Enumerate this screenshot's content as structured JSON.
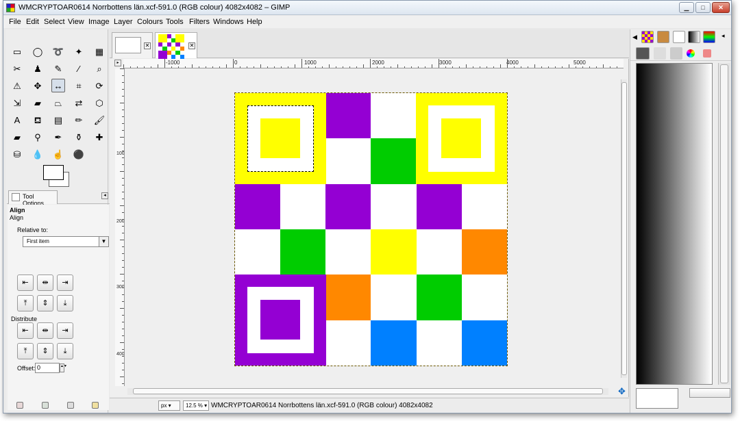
{
  "window": {
    "title": "WMCRYPTOAR0614 Norrbottens län.xcf-591.0 (RGB colour) 4082x4082 – GIMP",
    "buttons": {
      "minimize": "▁",
      "maximize": "□",
      "close": "✕"
    }
  },
  "menu": {
    "items": [
      "File",
      "Edit",
      "Select",
      "View",
      "Image",
      "Layer",
      "Colours",
      "Tools",
      "Filters",
      "Windows",
      "Help"
    ]
  },
  "toolbox": {
    "tools": [
      {
        "name": "rect-select-icon",
        "glyph": "▭"
      },
      {
        "name": "ellipse-select-icon",
        "glyph": "◯"
      },
      {
        "name": "lasso-icon",
        "glyph": "➰"
      },
      {
        "name": "fuzzy-select-icon",
        "glyph": "✦"
      },
      {
        "name": "color-select-icon",
        "glyph": "▦"
      },
      {
        "name": "scissors-icon",
        "glyph": "✂"
      },
      {
        "name": "foreground-select-icon",
        "glyph": "♟"
      },
      {
        "name": "paths-icon",
        "glyph": "✎"
      },
      {
        "name": "color-picker-icon",
        "glyph": "⁄"
      },
      {
        "name": "zoom-icon",
        "glyph": "⌕"
      },
      {
        "name": "measure-icon",
        "glyph": "⚠"
      },
      {
        "name": "move-icon",
        "glyph": "✥"
      },
      {
        "name": "align-icon",
        "glyph": "↔"
      },
      {
        "name": "crop-icon",
        "glyph": "⌗"
      },
      {
        "name": "rotate-icon",
        "glyph": "⟳"
      },
      {
        "name": "scale-icon",
        "glyph": "⇲"
      },
      {
        "name": "shear-icon",
        "glyph": "▰"
      },
      {
        "name": "perspective-icon",
        "glyph": "⏢"
      },
      {
        "name": "flip-icon",
        "glyph": "⇄"
      },
      {
        "name": "cage-icon",
        "glyph": "⬡"
      },
      {
        "name": "text-icon",
        "glyph": "A"
      },
      {
        "name": "bucket-fill-icon",
        "glyph": "⛾"
      },
      {
        "name": "blend-icon",
        "glyph": "▤"
      },
      {
        "name": "pencil-icon",
        "glyph": "✏"
      },
      {
        "name": "paintbrush-icon",
        "glyph": "🖌"
      },
      {
        "name": "eraser-icon",
        "glyph": "▰"
      },
      {
        "name": "airbrush-icon",
        "glyph": "⚲"
      },
      {
        "name": "ink-icon",
        "glyph": "✒"
      },
      {
        "name": "clone-icon",
        "glyph": "⚱"
      },
      {
        "name": "heal-icon",
        "glyph": "✚"
      },
      {
        "name": "perspective-clone-icon",
        "glyph": "⛁"
      },
      {
        "name": "blur-icon",
        "glyph": "💧"
      },
      {
        "name": "smudge-icon",
        "glyph": "☝"
      },
      {
        "name": "dodge-burn-icon",
        "glyph": "⚫"
      }
    ],
    "selected_tool": "align-icon"
  },
  "tool_options": {
    "tab_label": "Tool Options",
    "heading": "Align",
    "subheading": "Align",
    "relative_label": "Relative to:",
    "relative_value": "First item",
    "distribute_label": "Distribute",
    "offset_label": "Offset:",
    "offset_value": "0",
    "align_buttons": [
      "⇤",
      "⇹",
      "⇥",
      "⤒",
      "⇕",
      "⤓"
    ],
    "distribute_buttons": [
      "⇤",
      "⇹",
      "⇥",
      "⤒",
      "⇕",
      "⤓"
    ]
  },
  "rulers": {
    "h_labels": [
      "-1000",
      "0",
      "1000",
      "2000",
      "3000",
      "4000",
      "5000"
    ],
    "v_labels": [
      "1000",
      "2000",
      "3000",
      "4000"
    ]
  },
  "board": {
    "colors": {
      "yellow": "#ffff00",
      "purple": "#9400d3",
      "green": "#00cc00",
      "orange": "#ff8800",
      "blue": "#0080ff",
      "white": "#ffffff"
    },
    "grid": [
      [
        "F",
        "F",
        "purple",
        "white",
        "F",
        "F"
      ],
      [
        "F",
        "F",
        "white",
        "green",
        "F",
        "F"
      ],
      [
        "purple",
        "white",
        "purple",
        "white",
        "purple",
        "white"
      ],
      [
        "white",
        "green",
        "white",
        "yellow",
        "white",
        "orange"
      ],
      [
        "F",
        "F",
        "orange",
        "white",
        "green",
        "white"
      ],
      [
        "F",
        "F",
        "white",
        "blue",
        "white",
        "blue"
      ]
    ],
    "finders": [
      {
        "pos": "top-left",
        "color": "#ffff00",
        "selected": true
      },
      {
        "pos": "top-right",
        "color": "#ffff00",
        "selected": false
      },
      {
        "pos": "bottom-left",
        "color": "#9400d3",
        "selected": false
      }
    ]
  },
  "status": {
    "unit": "px",
    "zoom": "12.5 %",
    "message": "WMCRYPTOAR0614 Norrbottens län.xcf-591.0 (RGB colour) 4082x4082"
  },
  "right_dock": {
    "gradient": [
      "#000000",
      "#ffffff"
    ]
  }
}
